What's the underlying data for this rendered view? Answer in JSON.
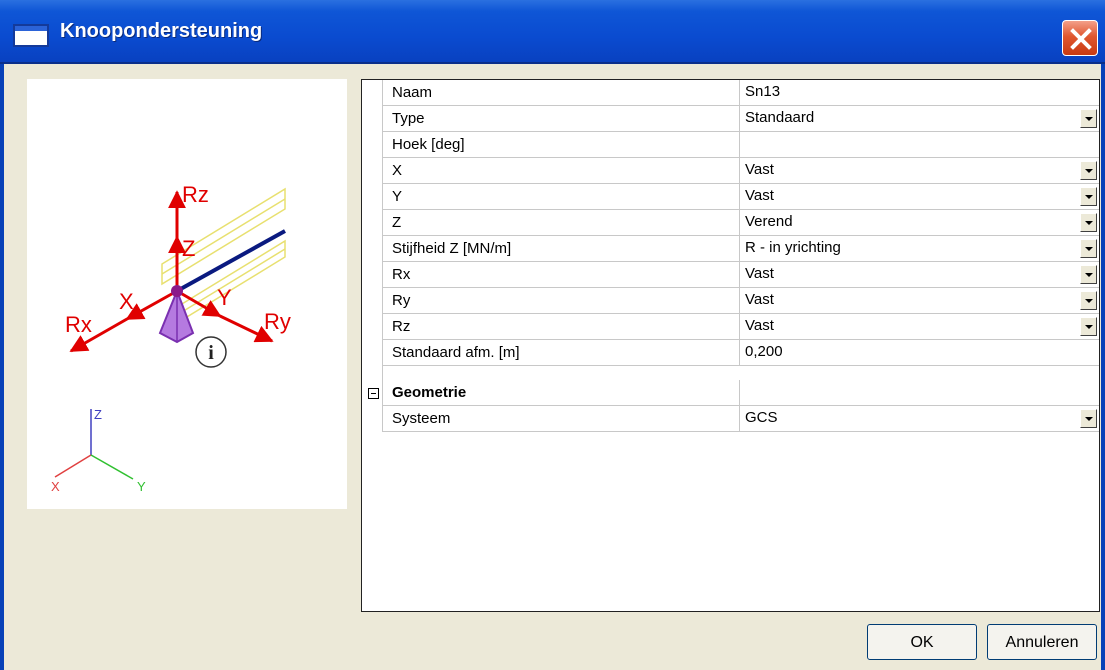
{
  "window": {
    "title": "Knoopondersteuning"
  },
  "preview": {
    "support_labels": {
      "rz": "Rz",
      "z": "Z",
      "x": "X",
      "y": "Y",
      "rx": "Rx",
      "ry": "Ry",
      "info": "i"
    },
    "axes_labels": {
      "z": "Z",
      "x": "X",
      "y": "Y"
    }
  },
  "properties": {
    "rows": [
      {
        "key": "Naam",
        "value": "Sn13"
      },
      {
        "key": "Type",
        "value": "Standaard"
      },
      {
        "key": "Hoek [deg]",
        "value": ""
      },
      {
        "key": "X",
        "value": "Vast"
      },
      {
        "key": "Y",
        "value": "Vast"
      },
      {
        "key": "Z",
        "value": "Verend"
      },
      {
        "key": "Stijfheid Z [MN/m]",
        "value": "R - in yrichting"
      },
      {
        "key": "Rx",
        "value": "Vast"
      },
      {
        "key": "Ry",
        "value": "Vast"
      },
      {
        "key": "Rz",
        "value": "Vast"
      },
      {
        "key": "Standaard afm. [m]",
        "value": "0,200"
      }
    ],
    "group": {
      "label": "Geometrie"
    },
    "group_rows": [
      {
        "key": "Systeem",
        "value": "GCS"
      }
    ]
  },
  "buttons": {
    "ok": "OK",
    "cancel": "Annuleren"
  },
  "colors": {
    "titlebar": "#0a4bd0",
    "close": "#e0572f",
    "support_arrows": "#e00000",
    "axis_x": "#e04040",
    "axis_y": "#30c030",
    "axis_z": "#4040c0"
  }
}
